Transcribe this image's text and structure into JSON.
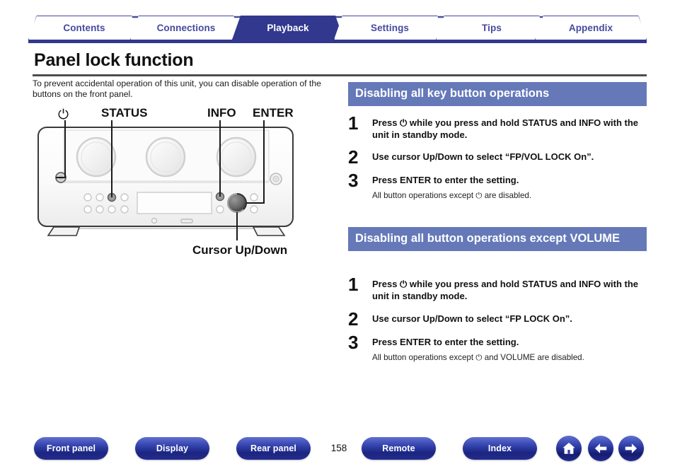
{
  "tabs": [
    {
      "label": "Contents",
      "active": false
    },
    {
      "label": "Connections",
      "active": false
    },
    {
      "label": "Playback",
      "active": true
    },
    {
      "label": "Settings",
      "active": false
    },
    {
      "label": "Tips",
      "active": false
    },
    {
      "label": "Appendix",
      "active": false
    }
  ],
  "page": {
    "title": "Panel lock function",
    "intro": "To prevent accidental operation of this unit, you can disable operation of the buttons on the front panel."
  },
  "diagram": {
    "labels": {
      "power": "⏻",
      "status": "STATUS",
      "info": "INFO",
      "enter": "ENTER",
      "cursor": "Cursor Up/Down"
    }
  },
  "sections": [
    {
      "heading": "Disabling all key button operations",
      "steps": [
        {
          "num": "1",
          "text": "Press ⏻ while you press and hold STATUS and INFO with the unit in standby mode.",
          "note": ""
        },
        {
          "num": "2",
          "text": "Use cursor Up/Down to select “FP/VOL LOCK On”.",
          "note": ""
        },
        {
          "num": "3",
          "text": "Press ENTER to enter the setting.",
          "note": "All button operations except ⏻ are disabled."
        }
      ]
    },
    {
      "heading": "Disabling all button operations except VOLUME",
      "steps": [
        {
          "num": "1",
          "text": "Press ⏻ while you press and hold STATUS and INFO with the unit in standby mode.",
          "note": ""
        },
        {
          "num": "2",
          "text": "Use cursor Up/Down to select “FP LOCK On”.",
          "note": ""
        },
        {
          "num": "3",
          "text": "Press ENTER to enter the setting.",
          "note": "All button operations except ⏻ and VOLUME are disabled."
        }
      ]
    }
  ],
  "bottom_nav": {
    "buttons": [
      {
        "label": "Front panel"
      },
      {
        "label": "Display"
      },
      {
        "label": "Rear panel"
      },
      {
        "label": "Remote"
      },
      {
        "label": "Index"
      }
    ],
    "page_number": "158",
    "icons": [
      {
        "name": "home-icon"
      },
      {
        "name": "arrow-left-icon"
      },
      {
        "name": "arrow-right-icon"
      }
    ]
  },
  "colors": {
    "tab_active_bg": "#32388e",
    "tab_text": "#454a9e",
    "section_header_bg": "#6579b9",
    "nav_button": "#2f3ea8"
  }
}
